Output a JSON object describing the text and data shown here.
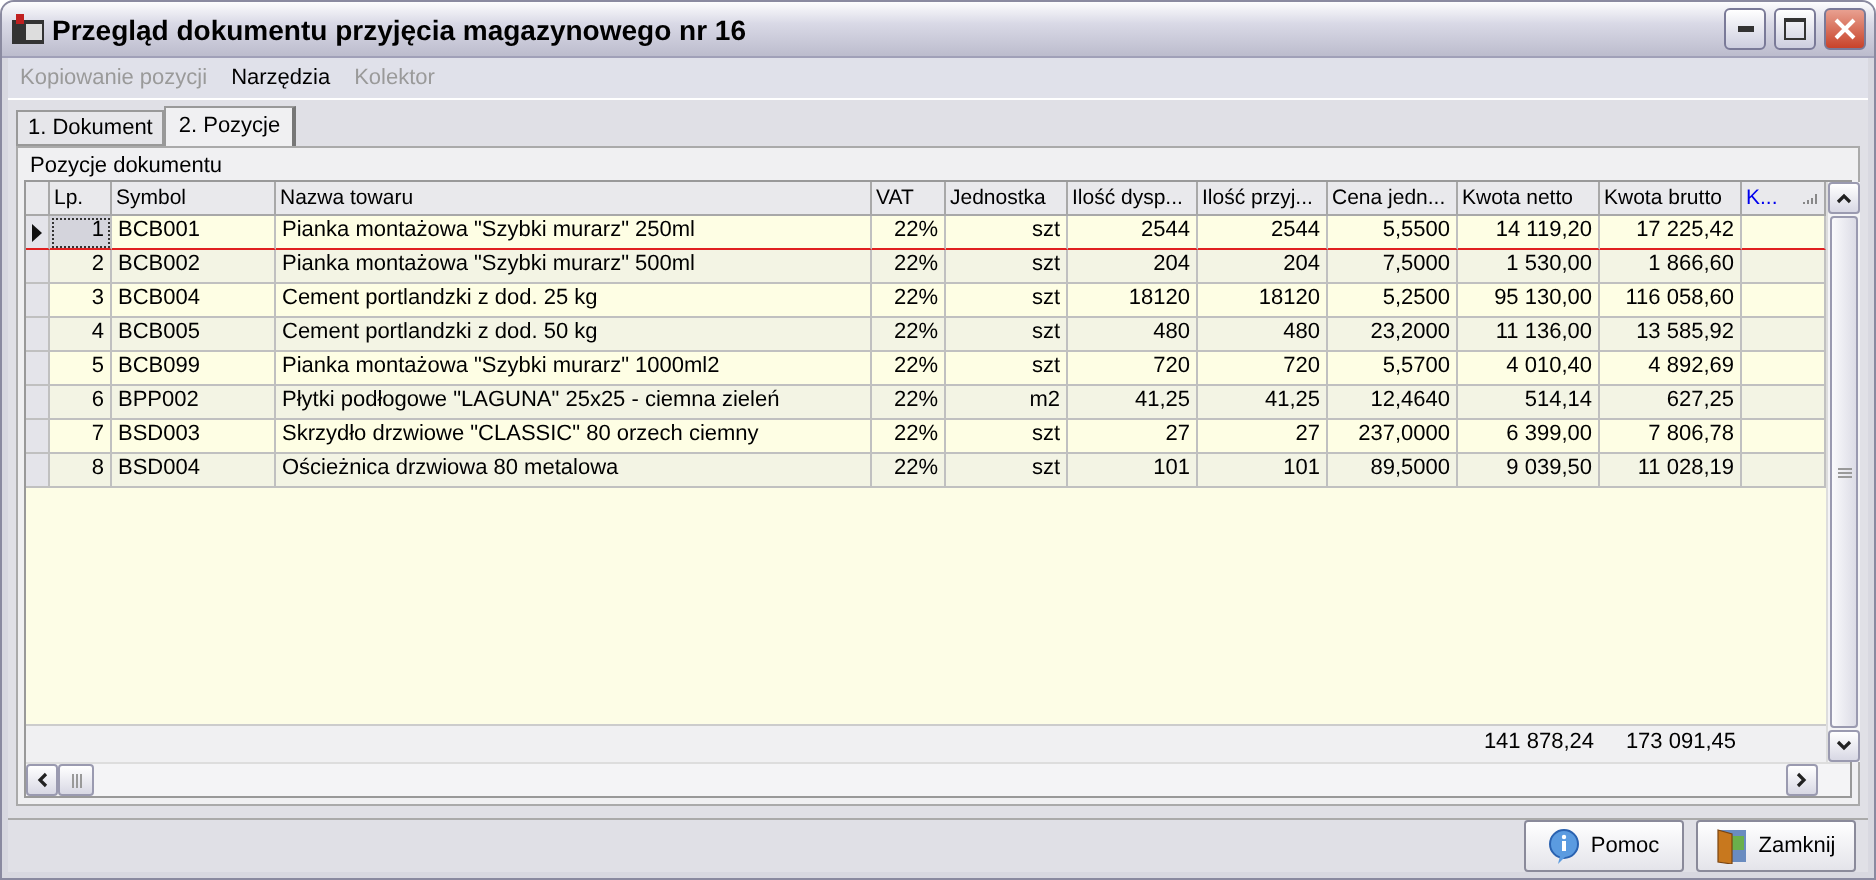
{
  "window": {
    "title": "Przegląd dokumentu przyjęcia magazynowego nr 16"
  },
  "menu": [
    {
      "label": "Kopiowanie pozycji",
      "disabled": true
    },
    {
      "label": "Narzędzia",
      "disabled": false
    },
    {
      "label": "Kolektor",
      "disabled": true
    }
  ],
  "tabs": [
    {
      "label": "1. Dokument",
      "selected": false
    },
    {
      "label": "2. Pozycje",
      "selected": true
    }
  ],
  "group": {
    "title": "Pozycje dokumentu"
  },
  "table": {
    "columns": [
      {
        "label": "Lp.",
        "highlighted": false
      },
      {
        "label": "Symbol",
        "highlighted": false
      },
      {
        "label": "Nazwa towaru",
        "highlighted": false
      },
      {
        "label": "VAT",
        "highlighted": false
      },
      {
        "label": "Jednostka",
        "highlighted": false
      },
      {
        "label": "Ilość dysp...",
        "highlighted": false
      },
      {
        "label": "Ilość przyj...",
        "highlighted": false
      },
      {
        "label": "Cena jedn...",
        "highlighted": false
      },
      {
        "label": "Kwota netto",
        "highlighted": false
      },
      {
        "label": "Kwota brutto",
        "highlighted": false
      },
      {
        "label": "K...",
        "highlighted": true
      }
    ],
    "rows": [
      {
        "selected": true,
        "cells": [
          "1",
          "BCB001",
          "Pianka montażowa \"Szybki murarz\" 250ml",
          "22%",
          "szt",
          "2544",
          "2544",
          "5,5500",
          "14 119,20",
          "17 225,42"
        ]
      },
      {
        "selected": false,
        "cells": [
          "2",
          "BCB002",
          "Pianka montażowa \"Szybki murarz\" 500ml",
          "22%",
          "szt",
          "204",
          "204",
          "7,5000",
          "1 530,00",
          "1 866,60"
        ]
      },
      {
        "selected": false,
        "cells": [
          "3",
          "BCB004",
          "Cement portlandzki z dod. 25 kg",
          "22%",
          "szt",
          "18120",
          "18120",
          "5,2500",
          "95 130,00",
          "116 058,60"
        ]
      },
      {
        "selected": false,
        "cells": [
          "4",
          "BCB005",
          "Cement portlandzki z dod. 50 kg",
          "22%",
          "szt",
          "480",
          "480",
          "23,2000",
          "11 136,00",
          "13 585,92"
        ]
      },
      {
        "selected": false,
        "cells": [
          "5",
          "BCB099",
          "Pianka montażowa \"Szybki murarz\" 1000ml2",
          "22%",
          "szt",
          "720",
          "720",
          "5,5700",
          "4 010,40",
          "4 892,69"
        ]
      },
      {
        "selected": false,
        "cells": [
          "6",
          "BPP002",
          "Płytki podłogowe \"LAGUNA\" 25x25 - ciemna zieleń",
          "22%",
          "m2",
          "41,25",
          "41,25",
          "12,4640",
          "514,14",
          "627,25"
        ]
      },
      {
        "selected": false,
        "cells": [
          "7",
          "BSD003",
          "Skrzydło drzwiowe \"CLASSIC\" 80 orzech ciemny",
          "22%",
          "szt",
          "27",
          "27",
          "237,0000",
          "6 399,00",
          "7 806,78"
        ]
      },
      {
        "selected": false,
        "cells": [
          "8",
          "BSD004",
          "Ościeżnica drzwiowa 80 metalowa",
          "22%",
          "szt",
          "101",
          "101",
          "89,5000",
          "9 039,50",
          "11 028,19"
        ]
      }
    ],
    "totals": {
      "kwota_netto": "141 878,24",
      "kwota_brutto": "173 091,45"
    }
  },
  "buttons": [
    {
      "label": "Pomoc",
      "kind": "help"
    },
    {
      "label": "Zamknij",
      "kind": "close"
    }
  ]
}
